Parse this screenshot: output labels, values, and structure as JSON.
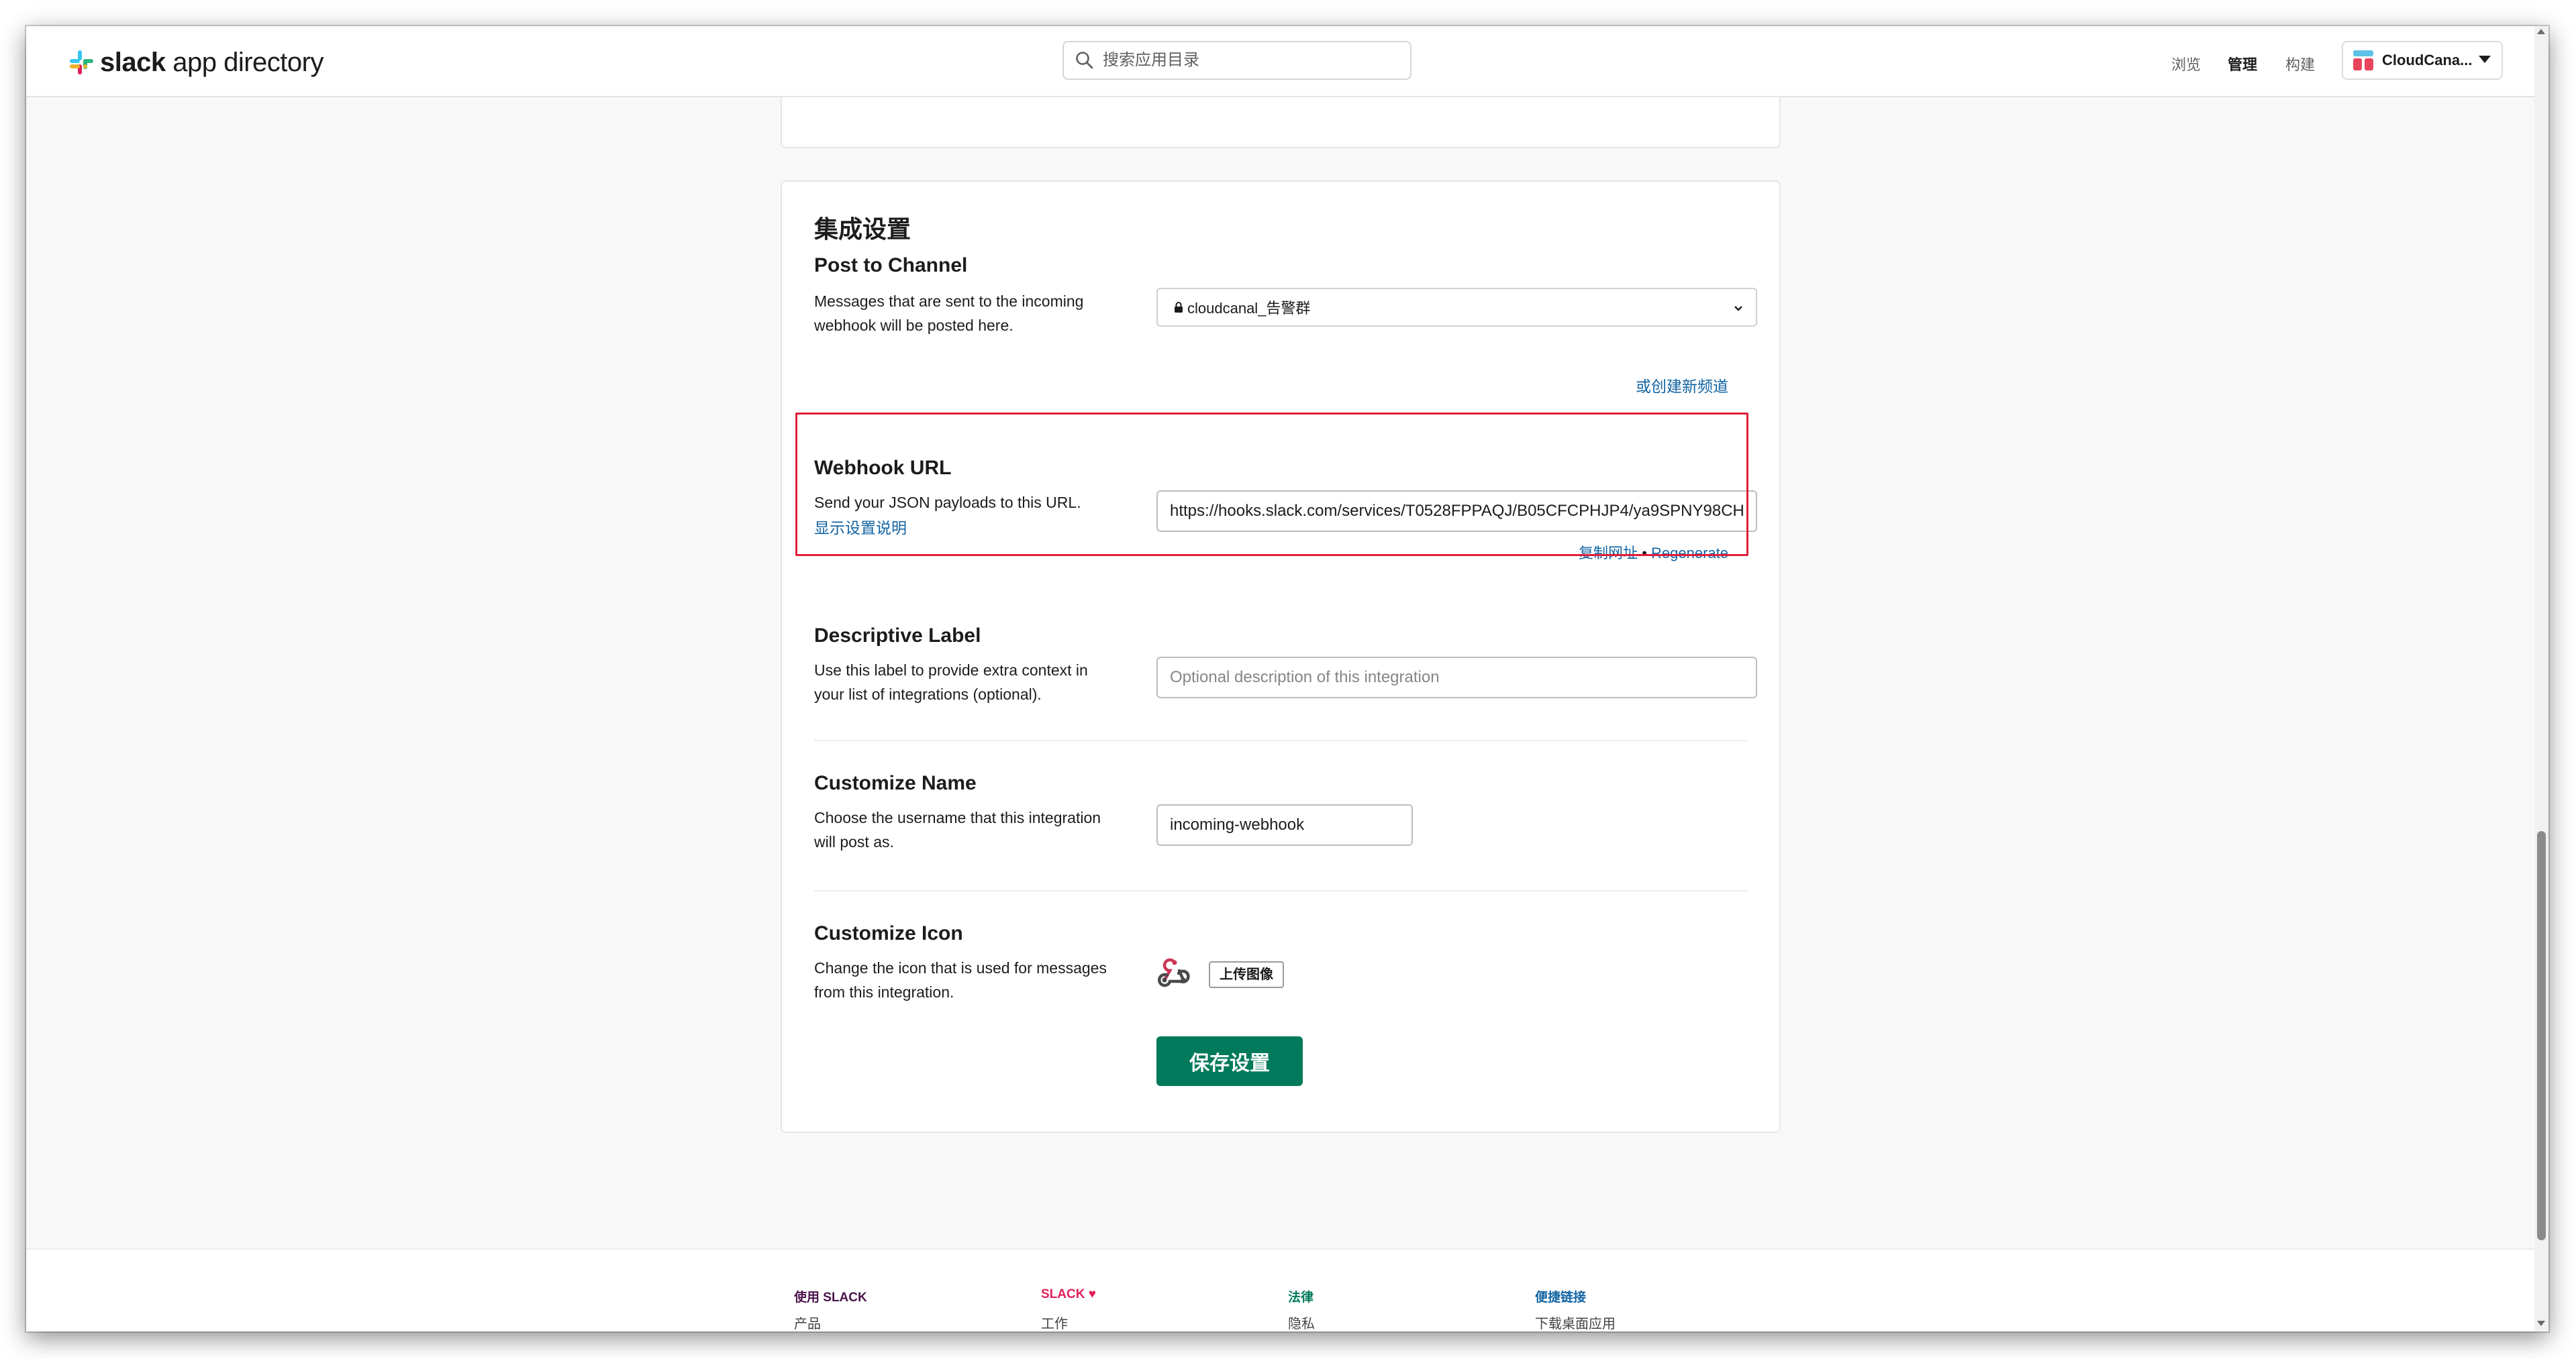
{
  "header": {
    "logo_text_bold": "slack",
    "logo_text_rest": " app directory",
    "search_placeholder": "搜索应用目录",
    "nav": [
      "浏览",
      "管理",
      "构建"
    ],
    "workspace_name": "CloudCana..."
  },
  "integration_settings": {
    "title": "集成设置",
    "post_to_channel": {
      "title": "Post to Channel",
      "description": "Messages that are sent to the incoming webhook will be posted here.",
      "selected_channel": "cloudcanal_告警群",
      "create_channel_link": "或创建新频道"
    },
    "webhook_url": {
      "title": "Webhook URL",
      "description": "Send your JSON payloads to this URL.",
      "show_instructions_link": "显示设置说明",
      "value": "https://hooks.slack.com/services/T0528FPPAQJ/B05CFCPHJP4/ya9SPNY98CH",
      "copy_link": "复制网址",
      "separator": "•",
      "regenerate_link": "Regenerate"
    },
    "descriptive_label": {
      "title": "Descriptive Label",
      "description": "Use this label to provide extra context in your list of integrations (optional).",
      "placeholder": "Optional description of this integration",
      "value": ""
    },
    "customize_name": {
      "title": "Customize Name",
      "description": "Choose the username that this integration will post as.",
      "value": "incoming-webhook"
    },
    "customize_icon": {
      "title": "Customize Icon",
      "description": "Change the icon that is used for messages from this integration.",
      "icon": "webhook-icon",
      "upload_button": "上传图像"
    },
    "save_button": "保存设置"
  },
  "footer": {
    "columns": [
      {
        "heading": "使用 SLACK",
        "first_item": "产品"
      },
      {
        "heading": "SLACK ♥",
        "first_item": "工作"
      },
      {
        "heading": "法律",
        "first_item": "隐私"
      },
      {
        "heading": "便捷链接",
        "first_item": "下载桌面应用"
      }
    ]
  },
  "colors": {
    "accent_green": "#007a5a",
    "link_blue": "#1264a3",
    "highlight_red": "#e01e3a",
    "footer_heading_1": "#4a154b",
    "footer_heading_2": "#e01e5a",
    "footer_heading_3": "#007a5a",
    "footer_heading_4": "#1264a3"
  }
}
